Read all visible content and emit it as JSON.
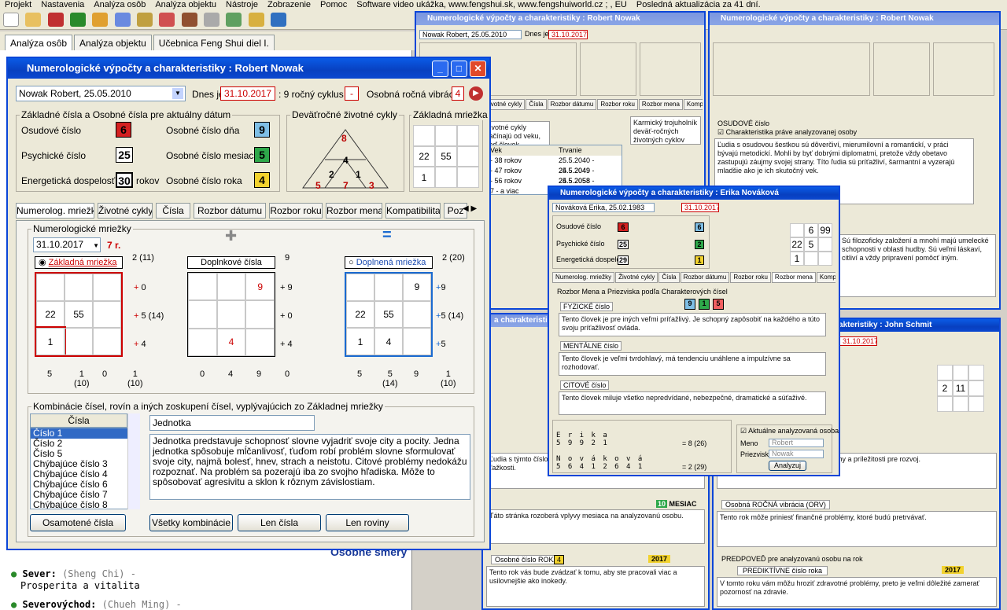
{
  "menubar": [
    "Projekt",
    "Nastavenia",
    "Analýza osôb",
    "Analýza objektu",
    "Nástroje",
    "Zobrazenie",
    "Pomoc",
    "Software video ukážka, www.fengshui.sk, www.fengshuiworld.cz ; , EU",
    "Posledná aktualizácia za 41 dní."
  ],
  "app_tabs": [
    "Analýza osôb",
    "Analýza objektu",
    "Učebnica Feng Shui diel I."
  ],
  "background": {
    "sever_label": "Sever:",
    "sever_alt": "(Sheng Chi) -",
    "sever_desc": "Prosperita a vitalita",
    "severovychod_label": "Severovýchod:",
    "severovychod_alt": "(Chueh Ming) -",
    "behind_text": "Osobné smery"
  },
  "main_window": {
    "title": "Numerologické výpočty a charakteristiky : Robert Nowak",
    "person_select": "Nowak Robert, 25.05.2010",
    "today_label": "Dnes je",
    "today_value": "31.10.2017",
    "cycle_label": ": 9 ročný cyklus",
    "cycle_value": "-",
    "vibration_label": "Osobná ročná vibrácia",
    "vibration_value": "4",
    "basic_numbers_title": "Základné čísla a Osobné čísla pre aktuálny dátum",
    "fate_label": "Osudové číslo",
    "fate_value": "6",
    "psychic_label": "Psychické číslo",
    "psychic_value": "25",
    "energy_label": "Energetická dospelosť",
    "energy_value": "30",
    "energy_unit": "rokov",
    "day_label": "Osobné číslo dňa",
    "day_value": "9",
    "month_label": "Osobné číslo mesiaca",
    "month_value": "5",
    "year_label": "Osobné číslo roka",
    "year_value": "4",
    "cycles_title": "Deväťročné životné cykly",
    "cycles_numbers": {
      "top": "8",
      "mid": "4",
      "left": "5",
      "center": "7",
      "right": "3",
      "inner_left": "2",
      "inner_right": "1"
    },
    "grid_title": "Základná mriežka",
    "grid_cells": [
      "",
      "",
      "",
      "22",
      "55",
      "",
      "1",
      "",
      ""
    ],
    "tabs": [
      "Numerolog. mriežky",
      "Životné cykly",
      "Čísla",
      "Rozbor dátumu",
      "Rozbor roku",
      "Rozbor mena",
      "Kompatibilita",
      "Poz"
    ],
    "grids_title": "Numerologické mriežky",
    "date_select": "31.10.2017",
    "age_label": "7 r.",
    "grid_a_label": "Základná mriežka",
    "grid_b_label": "Doplnkové čísla",
    "grid_c_label": "Doplnená mriežka",
    "grid_a": [
      "",
      "",
      "",
      "22",
      "55",
      "",
      "1",
      "",
      ""
    ],
    "grid_b": [
      "",
      "",
      "9",
      "",
      "",
      "",
      "",
      "4",
      ""
    ],
    "grid_c": [
      "",
      "",
      "9",
      "22",
      "55",
      "",
      "1",
      "4",
      ""
    ],
    "grid_a_diag_top": "2 (11)",
    "grid_a_rows": [
      "0",
      "5 (14)",
      "4"
    ],
    "grid_a_cols": [
      "5",
      "1\n(10)",
      "0"
    ],
    "grid_a_diag_bottom": "1\n(10)",
    "grid_b_diag_top": "9",
    "grid_b_rows": [
      "9",
      "0",
      "4"
    ],
    "grid_b_cols": [
      "0",
      "4",
      "9"
    ],
    "grid_b_diag_bottom": "0",
    "grid_c_diag_top": "2 (20)",
    "grid_c_rows": [
      "9",
      "5 (14)",
      "5"
    ],
    "grid_c_cols": [
      "5",
      "5\n(14)",
      "9"
    ],
    "grid_c_diag_bottom": "1\n(10)",
    "combos_title": "Kombinácie čísel, rovín a iných zoskupení čísel, vyplývajúcich zo Základnej mriežky",
    "list_header": "Čísla",
    "list_items": [
      "Číslo 1",
      "Číslo 2",
      "Číslo 5",
      "Chýbajúce číslo 3",
      "Chýbajúce číslo 4",
      "Chýbajúce číslo 6",
      "Chýbajúce číslo 7",
      "Chýbajúce číslo 8"
    ],
    "detail_title": "Jednotka",
    "detail_text": "Jednotka  predstavuje schopnosť slovne vyjadriť svoje city a pocity. Jedna jednotka spôsobuje mĺčanlivosť, ťuďom robí problém slovne sformulovať svoje city, najmä bolesť, hnev, strach a neistotu. Citové problémy nedokážu rozpoznať. Na problém sa pozerajú iba zo svojho hľadiska. Môže to spôsobovať agresivitu a sklon k rôznym závislostiam.",
    "btn_isolated": "Osamotené čísla",
    "btn_all": "Všetky kombinácie",
    "btn_numbers": "Len čísla",
    "btn_planes": "Len roviny"
  },
  "win_robert2": {
    "title": "Numerologické výpočty a charakteristiky : Robert Nowak",
    "person": "Nowak Robert, 25.05.2010",
    "today": "31.10.2017",
    "tabs": [
      "Numerolog. mriežky",
      "Životné cykly",
      "Čísla",
      "Rozbor dátumu",
      "Rozbor roku",
      "Rozbor mena",
      "Kompatibilita",
      "Poz"
    ],
    "cycles_text": "Životné cykly začínajú od veku, keď človek dosiahol vek ENERGETICKEJ dospelosti.",
    "table_head": [
      "Vek",
      "Trvanie"
    ],
    "table_rows": [
      [
        "- 38 rokov",
        "25.5.2040 - 24.5.2049"
      ],
      [
        "- 47 rokov",
        "25.5.2049 - 24.5.2058"
      ],
      [
        "- 56 rokov",
        "25.5.2058 - 24.5.2067"
      ],
      [
        "7 - a viac",
        "25.5.2067 - a viac"
      ]
    ],
    "karmic": "Karmický trojuholník deväť-ročných životných cyklov"
  },
  "win_robert3": {
    "title": "Numerologické výpočty a charakteristiky : Robert Nowak",
    "section": "OSUDOVÉ číslo",
    "checkbox": "Charakteristika práve analyzovanej osoby",
    "text": "Ľudia s osudovou šestkou sú dôverčiví, mierumilovní a romantickí, v práci bývajú metodickí. Mohli by byť dobrými diplomatmi, pretože vždy obetavo zastupujú záujmy svojej strany. Títo ľudia sú príťažliví, šarmantní a vyzerajú mladšie ako je ich skutočný vek.",
    "text2": "Sú filozoficky založení a mnohí majú umelecké schopnosti v oblasti hudby. Sú veľmi láskaví, citliví a vždy pripravení pomôcť iným."
  },
  "win_erika": {
    "title": "Numerologické výpočty a charakteristiky : Erika Nováková",
    "person": "Nováková Erika, 25.02.1983",
    "today": "31.10.2017",
    "fate": "6",
    "psychic": "25",
    "energy": "29",
    "day": "6",
    "month": "2",
    "year": "1",
    "grid": [
      "",
      "6",
      "99",
      "22",
      "5",
      "",
      "1",
      "",
      ""
    ],
    "section": "Rozbor Mena a Priezviska podľa Charakterových čísel",
    "physical_label": "FYZICKÉ číslo",
    "physical_value": "9",
    "mental_label": "MENTÁLNE číslo",
    "mental_value": "1",
    "emotional_label": "CITOVÉ číslo",
    "emotional_value": "5",
    "name_letters": [
      "E",
      "r",
      "i",
      "k",
      "a"
    ],
    "name_nums": [
      "5",
      "9",
      "9",
      "2",
      "1"
    ],
    "surname_letters": [
      "N",
      "o",
      "v",
      "á",
      "k",
      "o",
      "v",
      "á"
    ],
    "surname_nums": [
      "5",
      "6",
      "4",
      "1",
      "2",
      "6",
      "4",
      "1"
    ],
    "name_sum": "= 8 (26)",
    "surname_sum": "= 2 (29)",
    "analyzed": "Aktuálne analyzovaná osoba",
    "first_name_label": "Meno",
    "first_name": "Robert",
    "surname_label": "Priezvisko",
    "surname": "Nowak",
    "analyze_btn": "Analyzuj"
  },
  "win_john": {
    "title": "Numerologické výpočty a charakteristiky : John Schmit",
    "today": "31.10.2017",
    "grid": [
      "",
      "",
      "",
      "2",
      "11",
      "",
      "",
      "",
      ""
    ],
    "section1": "Osobná ROČNÁ vibrácia (ORV)",
    "section2": "PREDPOVEĎ pre analyzovanú osobu na rok",
    "forecast": "PREDIKTÍVNE číslo roka",
    "year": "2017"
  },
  "win_left": {
    "title": "a charakteristiky : J",
    "section": "Osobné číslo ROKA",
    "year": "2017",
    "value": "4",
    "month_label": "MESIAC",
    "month_val": "10"
  },
  "colors": {
    "red": "#cc0000",
    "blue_box": "#7fbfe6",
    "green_box": "#2ea84a",
    "yellow_box": "#f2d22e",
    "red_box": "#d42020",
    "title_blue": "#0a5be6"
  }
}
